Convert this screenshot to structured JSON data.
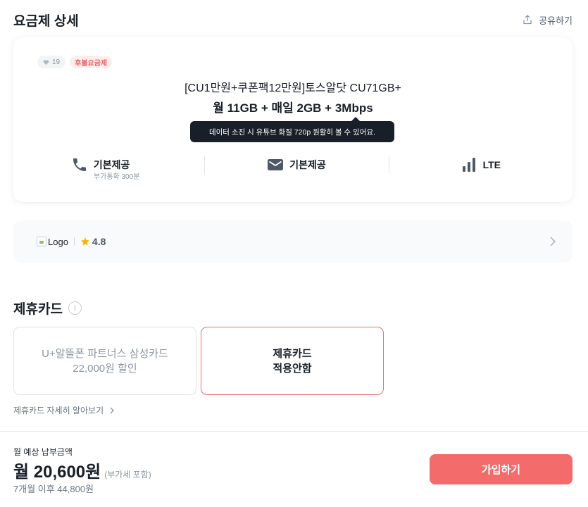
{
  "header": {
    "title": "요금제 상세",
    "share_label": "공유하기",
    "share_icon": "share-icon"
  },
  "plan": {
    "like_count": "19",
    "like_icon": "heart-icon",
    "type_badge": "후불요금제",
    "name": "[CU1만원+쿠폰팩12만원]토스알닷 CU71GB+",
    "summary": "월 11GB + 매일 2GB + 3Mbps",
    "tooltip": "데이터 소진 시 유튜브 화질 720p 원활히 볼 수 있어요.",
    "features": {
      "call": {
        "icon": "phone-icon",
        "label": "기본제공",
        "sub": "부가통화 300분"
      },
      "sms": {
        "icon": "mail-icon",
        "label": "기본제공"
      },
      "network": {
        "icon": "signal-bars-icon",
        "label": "LTE"
      }
    }
  },
  "carrier": {
    "logo_alt": "Logo",
    "rating": "4.8",
    "rating_icon": "star-icon",
    "star_color": "#f7b500"
  },
  "partner_cards": {
    "title": "제휴카드",
    "info_icon": "i",
    "options": [
      {
        "line1": "U+알뜰폰 파트너스 삼성카드",
        "line2": "22,000원 할인",
        "selected": false
      },
      {
        "line1": "제휴카드",
        "line2": "적용안함",
        "selected": true
      }
    ],
    "more_link": "제휴카드 자세히 알아보기"
  },
  "footer": {
    "price_label": "월 예상 납부금액",
    "price": "월 20,600원",
    "vat_note": "(부가세 포함)",
    "after_price": "7개월 이후 44,800원",
    "join_button": "가입하기"
  },
  "colors": {
    "accent": "#f36b6b",
    "text": "#191f28",
    "muted": "#8b95a1"
  }
}
